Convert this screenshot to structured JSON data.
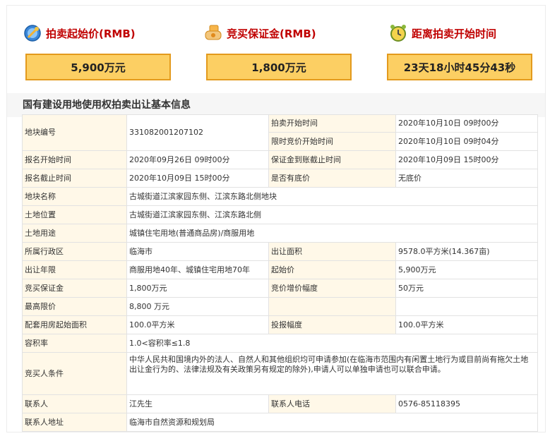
{
  "summary": {
    "start_price_title": "拍卖起始价(RMB)",
    "start_price_value": "5,900万元",
    "deposit_title": "竞买保证金(RMB)",
    "deposit_value": "1,800万元",
    "countdown_title": "距离拍卖开始时间",
    "countdown_value": "23天18小时45分43秒"
  },
  "icons": {
    "start_price": "price-tag-icon",
    "deposit": "money-hand-icon",
    "countdown": "alarm-clock-icon"
  },
  "section_title": "国有建设用地使用权拍卖出让基本信息",
  "table": {
    "plot_number_label": "地块编号",
    "plot_number": "331082001207102",
    "auction_start_label": "拍卖开始时间",
    "auction_start": "2020年10月10日 09时00分",
    "timed_bidding_label": "限时竞价开始时间",
    "timed_bidding": "2020年10月10日 09时04分",
    "registration_start_label": "报名开始时间",
    "registration_start": "2020年09月26日 09时00分",
    "deposit_deadline_label": "保证金到账截止时间",
    "deposit_deadline": "2020年10月09日 15时00分",
    "registration_end_label": "报名截止时间",
    "registration_end": "2020年10月09日 15时00分",
    "reserve_price_label": "是否有底价",
    "reserve_price": "无底价",
    "plot_name_label": "地块名称",
    "plot_name": "古城街道江滨家园东侧、江滨东路北侧地块",
    "location_label": "土地位置",
    "location": "古城街道江滨家园东侧、江滨东路北侧",
    "land_use_label": "土地用途",
    "land_use": "城镇住宅用地(普通商品房)/商服用地",
    "district_label": "所属行政区",
    "district": "临海市",
    "area_label": "出让面积",
    "area": "9578.0平方米(14.367亩)",
    "term_label": "出让年限",
    "term": "商服用地40年、城镇住宅用地70年",
    "starting_price_label": "起始价",
    "starting_price": "5,900万元",
    "bid_deposit_label": "竞买保证金",
    "bid_deposit": "1,800万元",
    "increment_label": "竞价增价幅度",
    "increment": "50万元",
    "max_price_label": "最高限价",
    "max_price": "8,800 万元",
    "housing_area_label": "配套用房起始面积",
    "housing_area": "100.0平方米",
    "bid_step_label": "投报幅度",
    "bid_step": "100.0平方米",
    "plot_ratio_label": "容积率",
    "plot_ratio": "1.0<容积率≤1.8",
    "bidder_conditions_label": "竞买人条件",
    "bidder_conditions": "中华人民共和国境内外的法人、自然人和其他组织均可申请参加(在临海市范围内有闲置土地行为或目前尚有拖欠土地出让金行为的、法律法规及有关政策另有规定的除外),申请人可以单独申请也可以联合申请。",
    "contact_label": "联系人",
    "contact": "江先生",
    "phone_label": "联系人电话",
    "phone": "0576-85118395",
    "address_label": "联系人地址",
    "address": "临海市自然资源和规划局"
  }
}
